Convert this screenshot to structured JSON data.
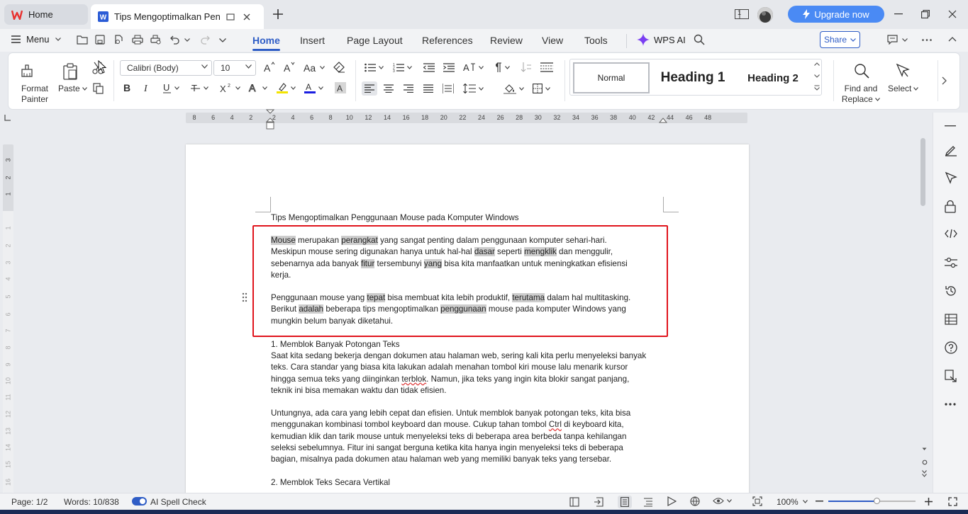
{
  "titlebar": {
    "home_tab": "Home",
    "doc_tab": "Tips Mengoptimalkan Penggu",
    "upgrade": "Upgrade now",
    "badge": "1"
  },
  "menu": {
    "menu_label": "Menu",
    "tabs": [
      "Home",
      "Insert",
      "Page Layout",
      "References",
      "Review",
      "View",
      "Tools"
    ],
    "wps_ai": "WPS AI",
    "share": "Share"
  },
  "ribbon": {
    "format_painter": "Format Painter",
    "paste": "Paste",
    "font_name": "Calibri (Body)",
    "font_size": "10",
    "styles": [
      "Normal",
      "Heading 1",
      "Heading 2"
    ],
    "find_replace": "Find and Replace",
    "select": "Select"
  },
  "ruler": {
    "h_numbers": [
      "8",
      "6",
      "4",
      "2",
      "2",
      "4",
      "6",
      "8",
      "10",
      "12",
      "14",
      "16",
      "18",
      "20",
      "22",
      "24",
      "26",
      "28",
      "30",
      "32",
      "34",
      "36",
      "38",
      "40",
      "42",
      "44",
      "46",
      "48"
    ],
    "v_numbers": [
      "3",
      "2",
      "1",
      "1",
      "2",
      "3",
      "4",
      "5",
      "6",
      "7",
      "8",
      "9",
      "10",
      "11",
      "12",
      "13",
      "14",
      "15",
      "16"
    ]
  },
  "document": {
    "title": "Tips Mengoptimalkan Penggunaan Mouse pada Komputer Windows",
    "p1": [
      [
        {
          "t": "Mouse",
          "h": true
        },
        {
          "t": " merupakan "
        },
        {
          "t": "perangkat",
          "h": true
        },
        {
          "t": " yang sangat penting dalam penggunaan komputer sehari-hari."
        }
      ],
      [
        {
          "t": "Meskipun mouse sering digunakan hanya untuk hal-hal "
        },
        {
          "t": "dasar",
          "h": true
        },
        {
          "t": " seperti "
        },
        {
          "t": "mengklik",
          "h": true
        },
        {
          "t": " dan menggulir,"
        }
      ],
      [
        {
          "t": "sebenarnya ada banyak "
        },
        {
          "t": "fitur",
          "h": true
        },
        {
          "t": " tersembunyi "
        },
        {
          "t": "yang",
          "h": true
        },
        {
          "t": " bisa kita manfaatkan untuk meningkatkan efisiensi"
        }
      ],
      [
        {
          "t": "kerja."
        }
      ]
    ],
    "p2": [
      [
        {
          "t": "Penggunaan mouse yang "
        },
        {
          "t": "tepat",
          "h": true
        },
        {
          "t": " bisa membuat kita lebih produktif, "
        },
        {
          "t": "terutama",
          "h": true
        },
        {
          "t": " dalam hal multitasking."
        }
      ],
      [
        {
          "t": "Berikut "
        },
        {
          "t": "adalah",
          "h": true
        },
        {
          "t": " beberapa tips mengoptimalkan "
        },
        {
          "t": "penggunaan",
          "h": true
        },
        {
          "t": " mouse pada komputer Windows yang"
        }
      ],
      [
        {
          "t": "mungkin belum banyak diketahui."
        }
      ]
    ],
    "s1_heading": "1. Memblok Banyak Potongan Teks",
    "p3": [
      [
        {
          "t": "Saat kita sedang bekerja dengan dokumen atau halaman web, sering kali kita perlu menyeleksi banyak"
        }
      ],
      [
        {
          "t": "teks. Cara standar yang biasa kita lakukan adalah menahan tombol kiri mouse lalu menarik kursor"
        }
      ],
      [
        {
          "t": "hingga semua teks yang diinginkan "
        },
        {
          "t": "terblok",
          "s": true
        },
        {
          "t": ". Namun, jika teks yang ingin kita blokir sangat panjang,"
        }
      ],
      [
        {
          "t": "teknik ini bisa memakan waktu dan tidak efisien."
        }
      ]
    ],
    "p4": [
      [
        {
          "t": "Untungnya, ada cara yang lebih cepat dan efisien. Untuk memblok banyak potongan teks, kita bisa"
        }
      ],
      [
        {
          "t": "menggunakan kombinasi tombol keyboard dan mouse. Cukup tahan tombol "
        },
        {
          "t": "Ctrl",
          "s": true
        },
        {
          "t": " di keyboard kita,"
        }
      ],
      [
        {
          "t": "kemudian klik dan tarik mouse untuk menyeleksi teks di beberapa area berbeda tanpa kehilangan"
        }
      ],
      [
        {
          "t": "seleksi sebelumnya. Fitur ini sangat berguna ketika kita hanya ingin menyeleksi teks di beberapa"
        }
      ],
      [
        {
          "t": "bagian, misalnya pada dokumen atau halaman web yang memiliki banyak teks yang tersebar."
        }
      ]
    ],
    "s2_heading": "2. Memblok Teks Secara Vertikal"
  },
  "status": {
    "page": "Page: 1/2",
    "words": "Words: 10/838",
    "spell": "AI Spell Check",
    "zoom": "100%"
  },
  "colors": {
    "accent": "#2f5dc6",
    "highlight": "#cdcdcd",
    "redbox": "#e0141c",
    "upgrade": "#4a8af4"
  }
}
